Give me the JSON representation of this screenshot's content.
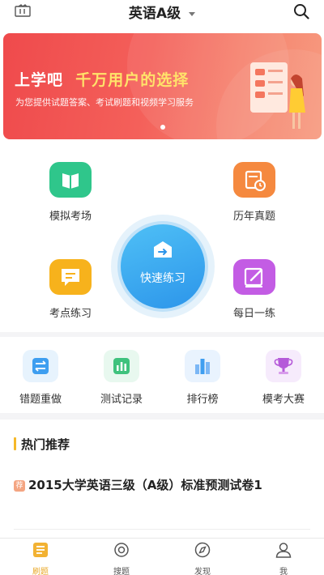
{
  "header": {
    "title": "英语A级"
  },
  "banner": {
    "title_part1": "上学吧",
    "title_part2": "千万用户的选择",
    "subtitle": "为您提供试题答案、考试刷题和视频学习服务"
  },
  "features": {
    "mock_exam": "模拟考场",
    "past_papers": "历年真题",
    "quick_practice": "快速练习",
    "point_practice": "考点练习",
    "daily_practice": "每日一练"
  },
  "tools": [
    {
      "label": "错题重做",
      "icon": "swap-icon"
    },
    {
      "label": "测试记录",
      "icon": "bar-chart-icon"
    },
    {
      "label": "排行榜",
      "icon": "ranking-icon"
    },
    {
      "label": "模考大赛",
      "icon": "trophy-icon"
    }
  ],
  "recommend": {
    "title": "热门推荐",
    "badge": "荐",
    "item_title": "2015大学英语三级（A级）标准预测试卷1"
  },
  "tabbar": [
    {
      "label": "刷题",
      "icon": "list-icon",
      "active": true
    },
    {
      "label": "搜题",
      "icon": "search-icon",
      "active": false
    },
    {
      "label": "发现",
      "icon": "compass-icon",
      "active": false
    },
    {
      "label": "我",
      "icon": "user-icon",
      "active": false
    }
  ],
  "colors": {
    "accent": "#e9a92a",
    "banner": "#ef4a4c",
    "quick": "#2c95ea",
    "green": "#2fc68b",
    "orange": "#f5893f",
    "yellow": "#f7b21c",
    "purple": "#c35ce4"
  }
}
